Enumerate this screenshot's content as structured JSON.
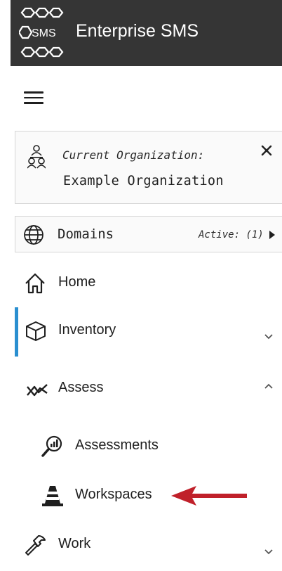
{
  "header": {
    "logo_text": "SMS",
    "title": "Enterprise SMS"
  },
  "menu": {
    "icon": "hamburger-menu-icon"
  },
  "organization": {
    "label": "Current Organization:",
    "name": "Example Organization",
    "icon": "organization-icon",
    "close_icon": "close-icon"
  },
  "domains": {
    "label": "Domains",
    "active": "Active: (1)",
    "icon": "globe-icon",
    "expand_icon": "triangle-right-icon"
  },
  "nav": {
    "items": [
      {
        "label": "Home",
        "icon": "home-icon"
      },
      {
        "label": "Inventory",
        "icon": "cube-icon",
        "expanded": false,
        "selected": true
      },
      {
        "label": "Assess",
        "icon": "assess-icon",
        "expanded": true
      },
      {
        "label": "Assessments",
        "icon": "magnifier-chart-icon"
      },
      {
        "label": "Workspaces",
        "icon": "traffic-cone-icon"
      },
      {
        "label": "Work",
        "icon": "hammer-icon",
        "expanded": false
      }
    ]
  },
  "colors": {
    "header_bg": "#353535",
    "accent": "#2a8fd0",
    "annotation_arrow": "#c0202a"
  }
}
